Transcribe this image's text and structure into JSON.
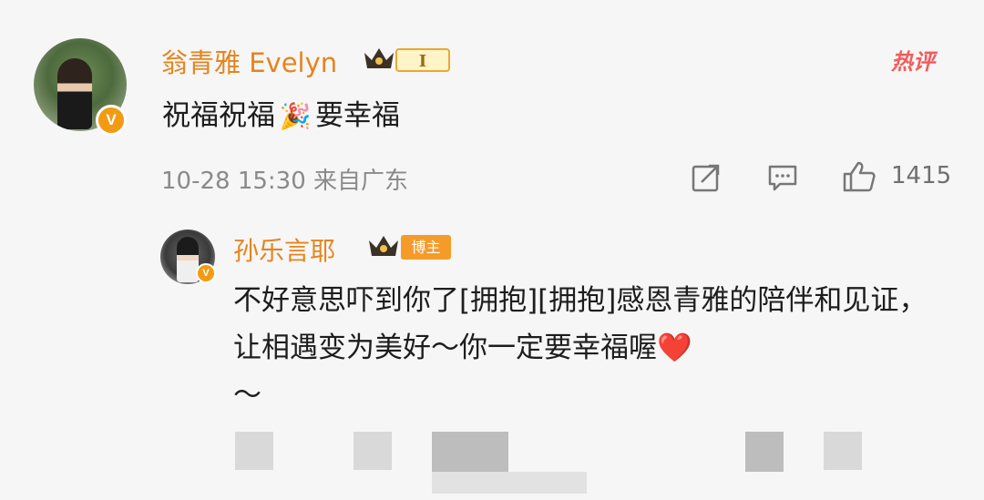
{
  "comment": {
    "username": "翁青雅 Evelyn",
    "level": "I",
    "hot_label": "热评",
    "text_before": "祝福祝福",
    "emoji": "🎉",
    "text_after": "要幸福",
    "timestamp": "10-28 15:30",
    "location": "来自广东",
    "like_count": "1415"
  },
  "reply": {
    "username": "孙乐言耶",
    "role_badge": "博主",
    "text": "不好意思吓到你了[拥抱][拥抱]感恩青雅的陪伴和见证，让相遇变为美好～你一定要幸福喔",
    "heart": "❤️",
    "trailing": "～"
  },
  "icons": {
    "share": "share-icon",
    "comment": "comment-icon",
    "like": "like-icon",
    "verified": "verified-badge-icon",
    "crown": "crown-icon"
  },
  "colors": {
    "username": "#e5841e",
    "verified": "#f29b12",
    "hot": "#f25c5c",
    "badge": "#f59b2a"
  }
}
